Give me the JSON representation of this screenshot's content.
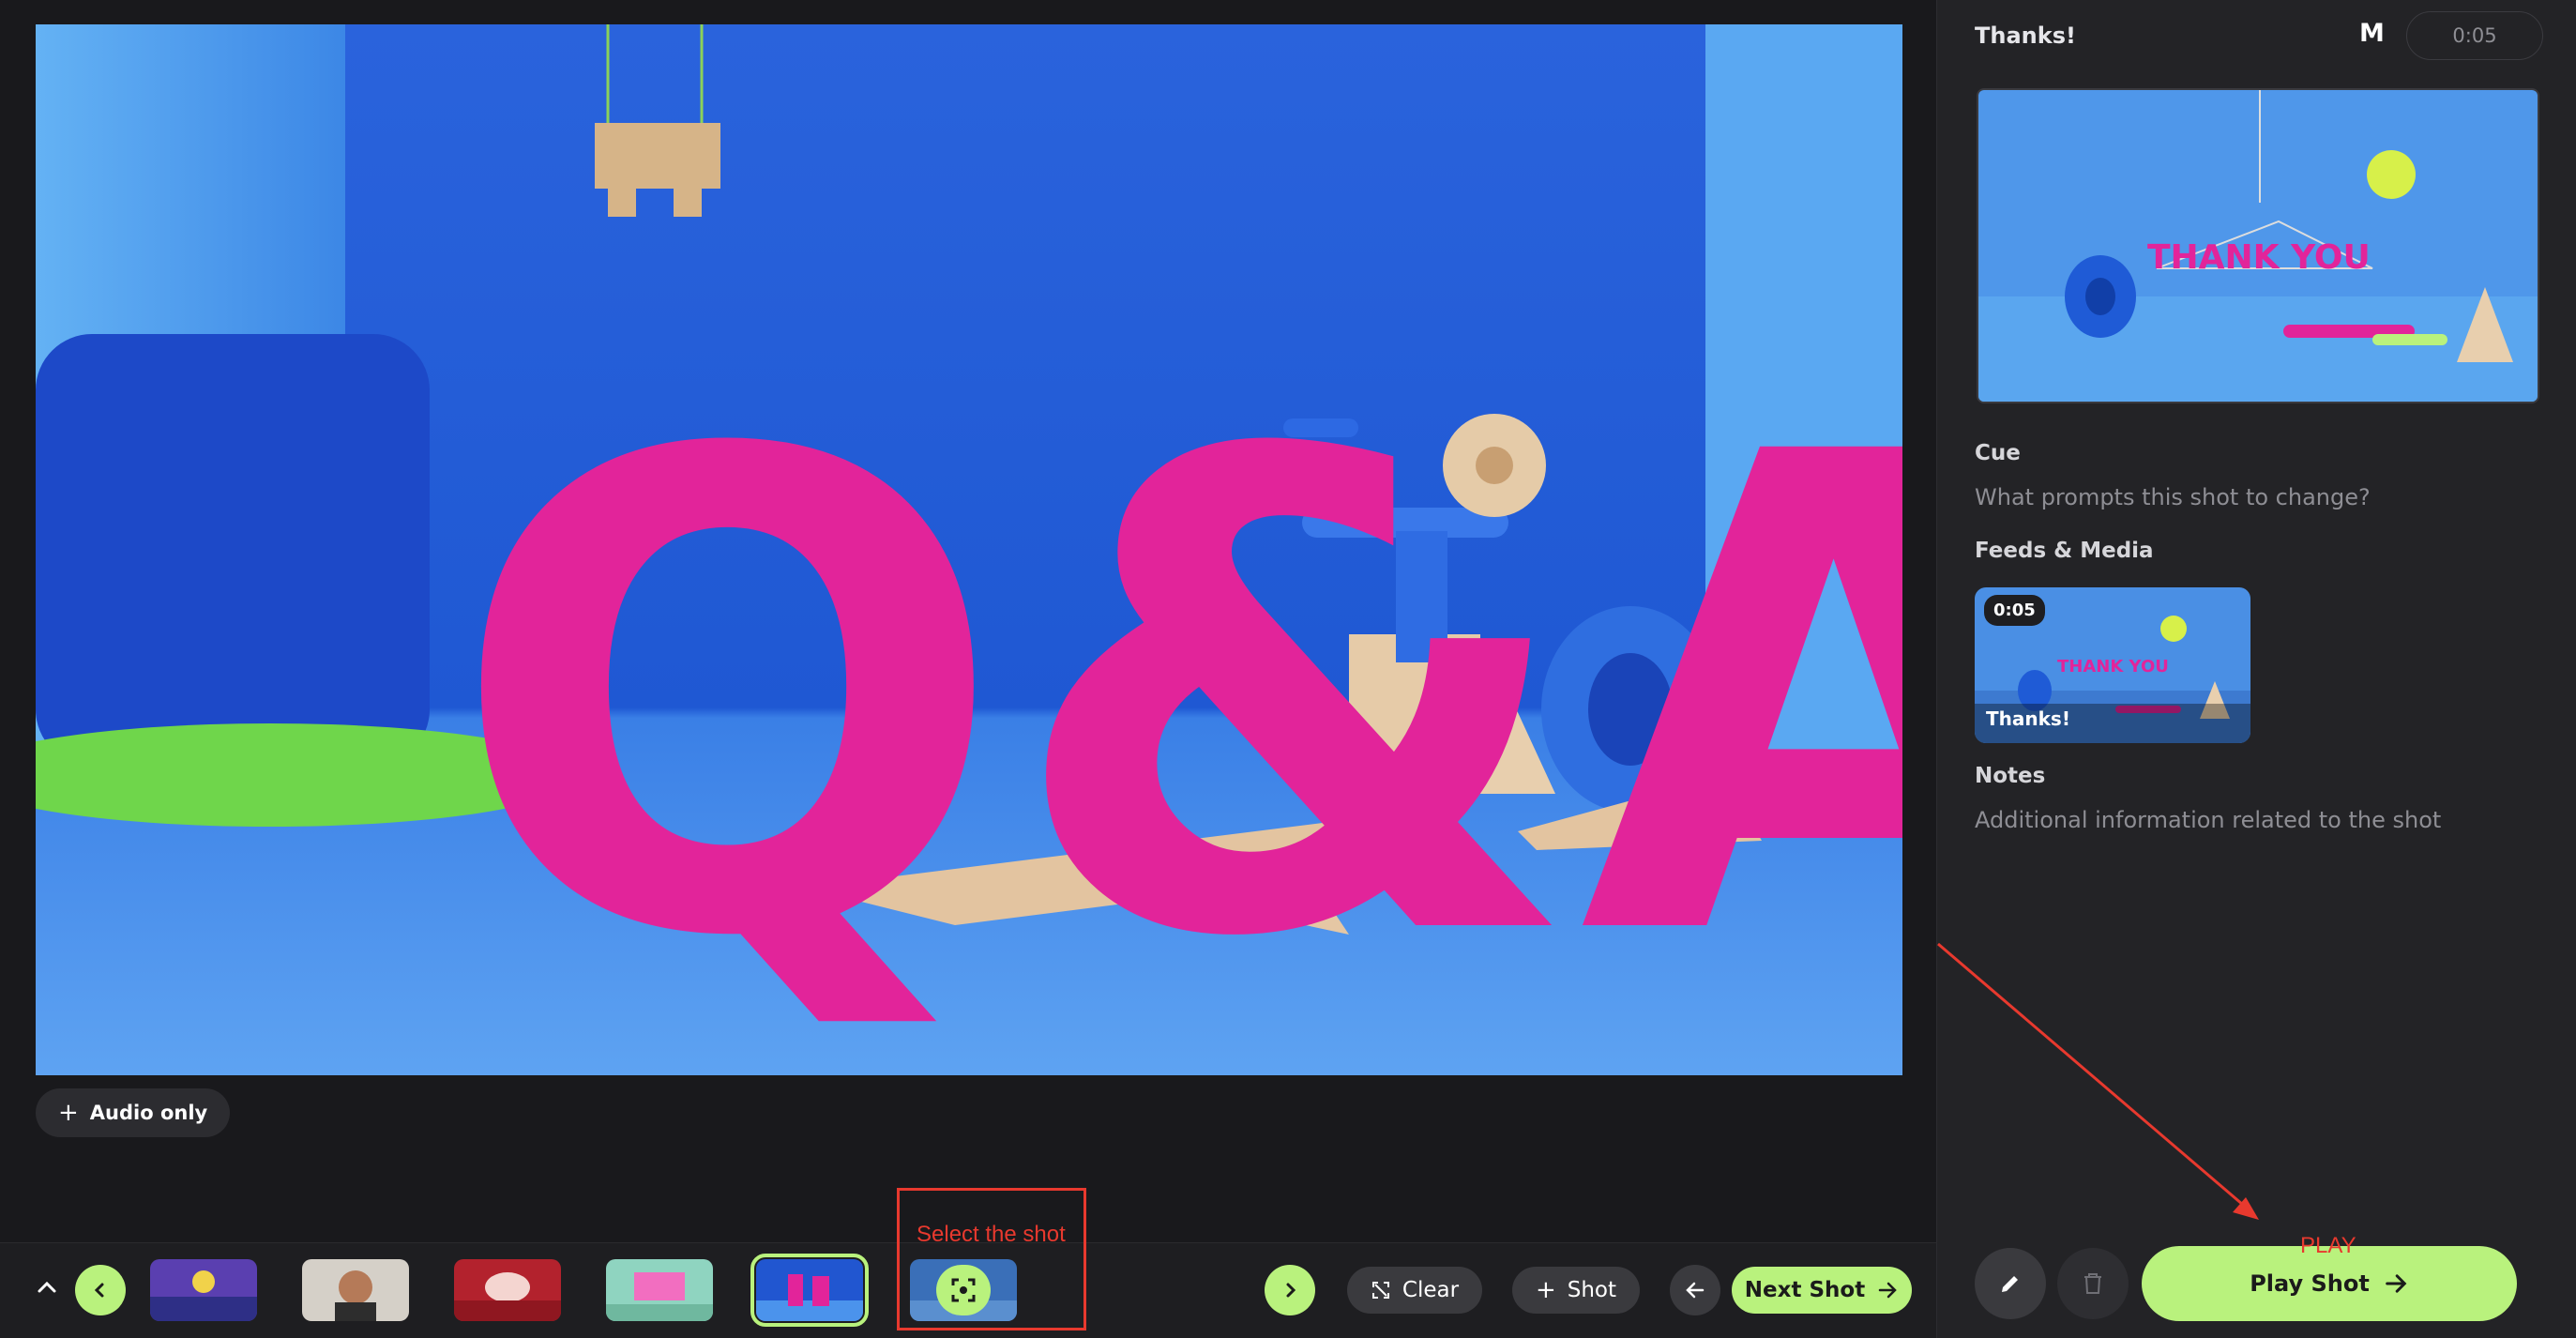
{
  "stage": {
    "audio_only_label": "Audio only",
    "preview_text": "Q&A"
  },
  "bottom_bar": {
    "clear_label": "Clear",
    "shot_label": "Shot",
    "next_shot_label": "Next Shot",
    "thumbnails": [
      "thumbnail-1",
      "thumbnail-2",
      "thumbnail-3",
      "thumbnail-4",
      "thumbnail-5",
      "thumbnail-6"
    ]
  },
  "annotations": {
    "select_text": "Select the shot",
    "play_text": "PLAY"
  },
  "sidebar": {
    "shot_title": "Thanks!",
    "avatar_letter": "M",
    "duration": "0:05",
    "preview_text": "THANK YOU",
    "cue_heading": "Cue",
    "cue_placeholder": "What prompts this shot to change?",
    "feeds_heading": "Feeds & Media",
    "feed_duration": "0:05",
    "feed_title": "Thanks!",
    "feed_preview_text": "THANK YOU",
    "notes_heading": "Notes",
    "notes_placeholder": "Additional information related to the shot",
    "play_shot_label": "Play Shot"
  },
  "colors": {
    "accent": "#b9f27d",
    "annotation": "#e8392e",
    "preview_blue": "#1f5bd6",
    "magenta": "#e2249a"
  }
}
